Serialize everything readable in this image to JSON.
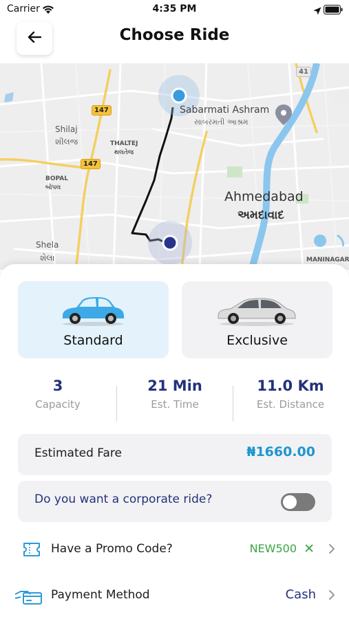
{
  "status_bar": {
    "carrier": "Carrier",
    "time": "4:35 PM"
  },
  "header": {
    "title": "Choose Ride"
  },
  "map": {
    "labels": {
      "shilaj": "Shilaj",
      "shilaj_gu": "શીલજ",
      "thaltej": "THALTEJ",
      "thaltej_gu": "થલતેજ",
      "bopal": "BOPAL",
      "bopal_gu": "બોપલ",
      "shela": "Shela",
      "shela_gu": "શેલા",
      "ashram": "Sabarmati Ashram",
      "ashram_gu": "સાબરમતી આશ્રમ",
      "city": "Ahmedabad",
      "city_gu": "અમદાવાદ",
      "maninagar": "MANINAGAR",
      "road_147": "147",
      "road_41": "41"
    }
  },
  "vehicles": [
    {
      "label": "Standard",
      "selected": true
    },
    {
      "label": "Exclusive",
      "selected": false
    }
  ],
  "stats": {
    "capacity": {
      "value": "3",
      "label": "Capacity"
    },
    "time": {
      "value": "21 Min",
      "label": "Est. Time"
    },
    "distance": {
      "value": "11.0 Km",
      "label": "Est. Distance"
    }
  },
  "fare": {
    "label": "Estimated Fare",
    "value": "₦1660.00"
  },
  "corporate": {
    "label": "Do you want a corporate ride?",
    "enabled": false
  },
  "promo": {
    "label": "Have a Promo Code?",
    "code": "NEW500"
  },
  "payment": {
    "label": "Payment Method",
    "value": "Cash"
  },
  "colors": {
    "accent": "#1e96cf",
    "navy": "#23327a",
    "promo_green": "#3aa542"
  },
  "icons": [
    "wifi-icon",
    "location-arrow-icon",
    "battery-icon",
    "back-arrow-icon",
    "pickup-pin-icon",
    "dropoff-pin-icon",
    "ticket-icon",
    "payment-card-icon",
    "chevron-right-icon",
    "close-x-icon"
  ]
}
